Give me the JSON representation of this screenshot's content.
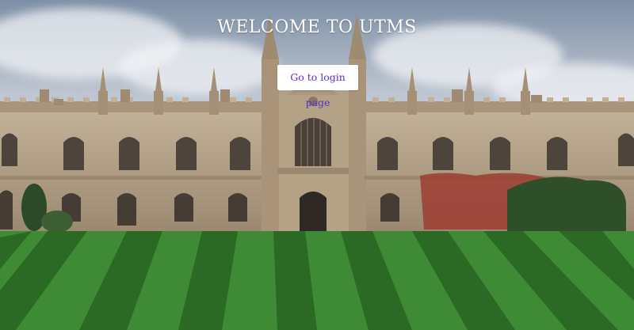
{
  "hero": {
    "title": "WELCOME TO UTMS"
  },
  "actions": {
    "login_link_label": "Go to login page"
  },
  "background": {
    "icon": "college-building-image",
    "colors": {
      "stone": "#b19e84",
      "stone_dark": "#8a7864",
      "grass_light": "#4a8f3a",
      "grass_dark": "#2f6b26",
      "link_text": "#5a2cc8"
    }
  }
}
